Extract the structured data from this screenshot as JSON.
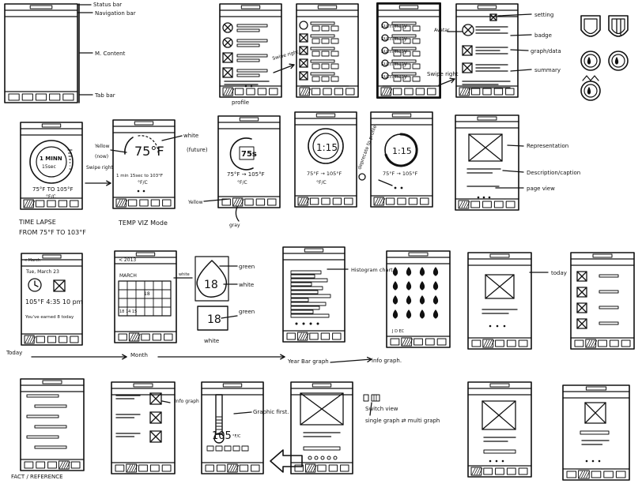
{
  "ink_color": "#111111",
  "labels": {
    "status_bar": "Status bar",
    "navigation_bar": "Navigation bar",
    "main_content": "M. Content",
    "tab_bar": "Tab bar",
    "swipe_right_1": "Swipe right",
    "swipe_right_2": "Swipe right",
    "swipe_right_3": "Swipe right",
    "profile": "profile",
    "avatar": "Avatar",
    "setting": "setting",
    "badge": "badge",
    "graph_data": "graph/data",
    "summary": "summary",
    "yellow_1": "Yellow",
    "yellow_now": "(now)",
    "white_future": "white",
    "white_future_sub": "(future)",
    "yellow_2": "Yellow",
    "gray": "gray",
    "deprecate_to_profile": "deprecate to profile",
    "time_lapse_1": "TIME LAPSE",
    "time_lapse_2": "FROM 75°F TO 103°F",
    "temp_viz_mode": "TEMP VIZ Mode",
    "representation": "Representation",
    "description": "Description/caption",
    "page_view": "page view",
    "white_cal": "white",
    "green_1": "green",
    "white_2": "white",
    "green_2": "green",
    "white_3": "white",
    "histogram_chart": "Histogram chart",
    "today_label": "today",
    "flow_today": "Today",
    "flow_month": "Month",
    "flow_year_bar": "Year Bar graph",
    "flow_info_graph": "info graph.",
    "info_graph": "Info graph",
    "graphic_first": "Graphic first.",
    "switch_view": "Switch view",
    "single_multi": "single graph ⇄ multi graph",
    "fact_reference": "FACT / REFERENCE"
  },
  "screens": {
    "time_lapse": {
      "line1": "1 MINN",
      "line2": "15sec",
      "range": "75°F TO 105°F",
      "unit": "°F/C"
    },
    "temp_viz": {
      "temp": "75°F",
      "range": "1 min 15sec to 103°F",
      "unit": "°F/C"
    },
    "viz3": {
      "temp": "75s",
      "range": "75°F → 105°F",
      "unit": "°F/C"
    },
    "viz4": {
      "time": "1:15",
      "range": "75°F → 105°F",
      "unit": "°F/C"
    },
    "viz5": {
      "time": "1:15",
      "range": "75°F → 105°F"
    },
    "today": {
      "nav": "< March",
      "date": "Tue, March 23",
      "stats": "105°F  4:35 10 pm",
      "earned": "You've earned 8 today"
    },
    "month": {
      "nav": "< 2013",
      "title": "MARCH",
      "day": "18",
      "week": "18 14 15"
    },
    "badge_green": {
      "day": "18"
    },
    "badge_white": {
      "day": "18"
    },
    "year": {
      "footer": "J   D EC"
    },
    "thermo": {
      "temp": "105",
      "unit": "°F/C"
    }
  }
}
